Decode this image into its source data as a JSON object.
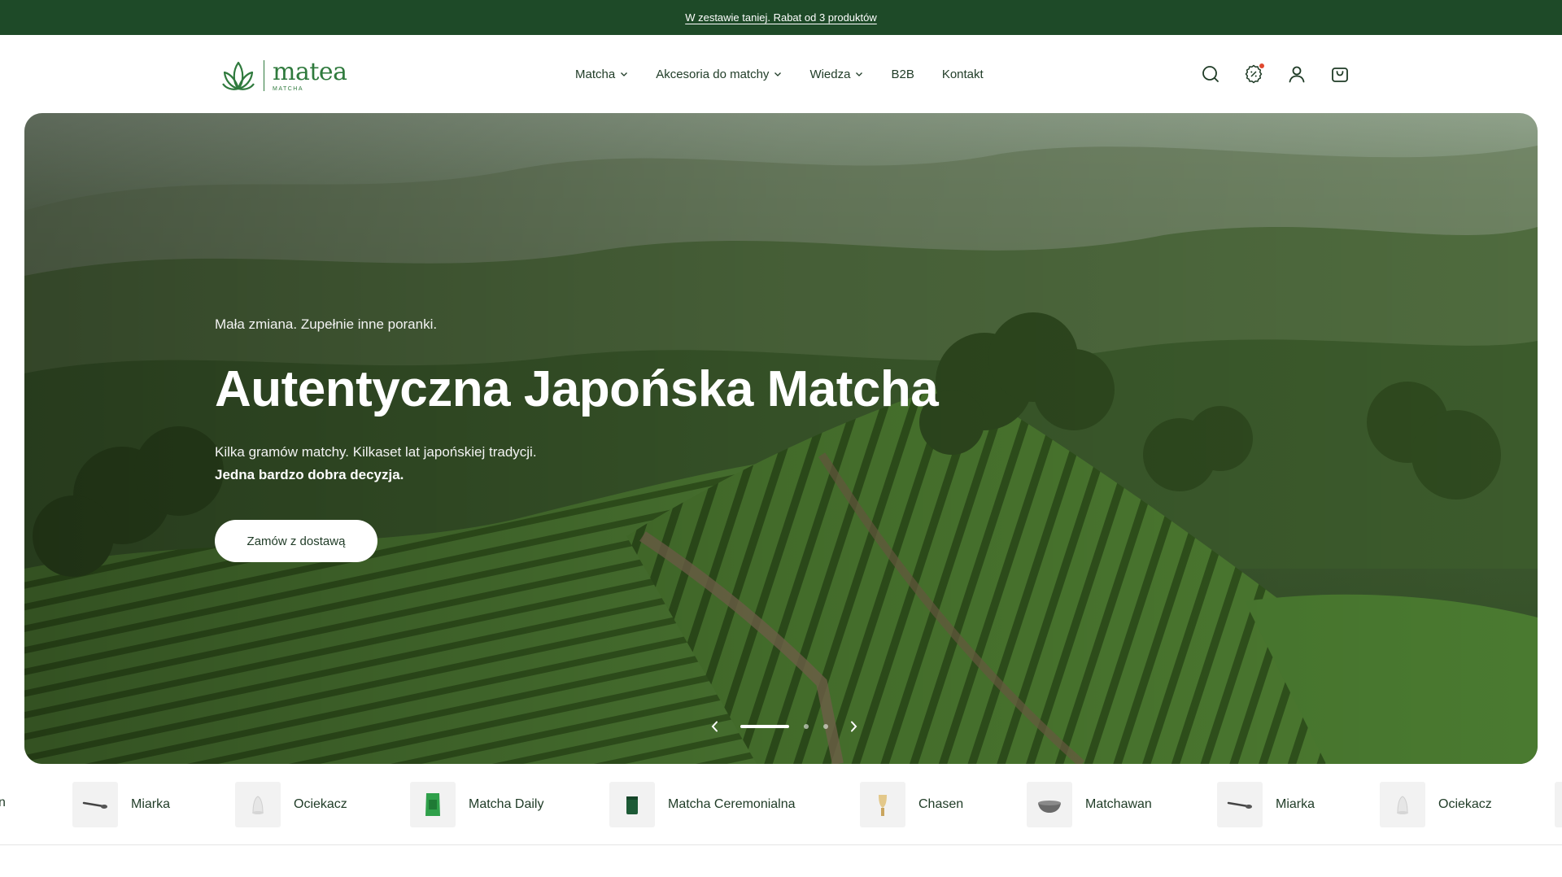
{
  "announcement": {
    "text": "W zestawie taniej. Rabat od 3 produktów"
  },
  "logo": {
    "word": "matea",
    "sub": "MATCHA"
  },
  "nav": [
    {
      "label": "Matcha",
      "dropdown": true
    },
    {
      "label": "Akcesoria do matchy",
      "dropdown": true
    },
    {
      "label": "Wiedza",
      "dropdown": true
    },
    {
      "label": "B2B",
      "dropdown": false
    },
    {
      "label": "Kontakt",
      "dropdown": false
    }
  ],
  "header_icons": [
    "search-icon",
    "discount-badge-icon",
    "account-icon",
    "cart-icon"
  ],
  "hero": {
    "pretitle": "Mała zmiana. Zupełnie inne poranki.",
    "title": "Autentyczna Japońska Matcha",
    "desc_line1": "Kilka gramów matchy. Kilkaset lat japońskiej tradycji.",
    "desc_line2": "Jedna bardzo dobra decyzja.",
    "cta": "Zamów z dostawą",
    "slides_count": 3,
    "active_slide": 1
  },
  "strip": {
    "partial_left": "n",
    "items": [
      {
        "label": "Miarka",
        "icon": "scoop-icon"
      },
      {
        "label": "Ociekacz",
        "icon": "whisk-holder-icon"
      },
      {
        "label": "Matcha Daily",
        "icon": "matcha-pouch-icon"
      },
      {
        "label": "Matcha Ceremonialna",
        "icon": "matcha-tin-icon"
      },
      {
        "label": "Chasen",
        "icon": "whisk-icon"
      },
      {
        "label": "Matchawan",
        "icon": "bowl-icon"
      },
      {
        "label": "Miarka",
        "icon": "scoop-icon"
      },
      {
        "label": "Ociekacz",
        "icon": "whisk-holder-icon"
      }
    ]
  },
  "colors": {
    "brand_green": "#2f7a3d",
    "announcement_bg": "#1e4a28",
    "text_dark": "#1f3b26"
  }
}
